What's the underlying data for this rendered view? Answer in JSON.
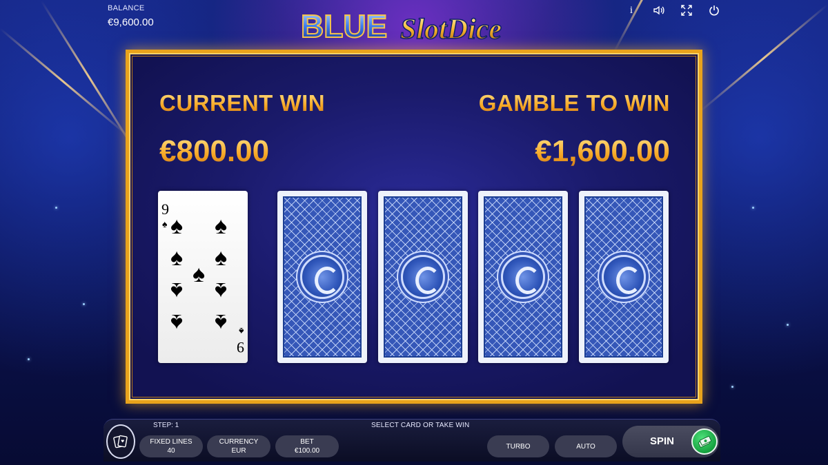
{
  "balance": {
    "label": "BALANCE",
    "value": "€9,600.00"
  },
  "logo": {
    "text_blue": "BLUE",
    "text_script": "SlotDice"
  },
  "top_icons": {
    "info": "i",
    "sound": "speaker-icon",
    "fullscreen": "fullscreen-icon",
    "power": "power-icon"
  },
  "gamble": {
    "current_win_label": "CURRENT WIN",
    "current_win_value": "€800.00",
    "gamble_label": "GAMBLE TO WIN",
    "gamble_value": "€1,600.00",
    "dealer_card": {
      "rank": "9",
      "suit": "♠"
    },
    "face_down_cards": 4
  },
  "bottom_bar": {
    "step": "STEP: 1",
    "message": "SELECT CARD OR TAKE WIN",
    "fixed_lines": {
      "label": "FIXED LINES",
      "value": "40"
    },
    "currency": {
      "label": "CURRENCY",
      "value": "EUR"
    },
    "bet": {
      "label": "BET",
      "value": "€100.00"
    },
    "turbo": "TURBO",
    "auto": "AUTO",
    "spin": "SPIN"
  },
  "colors": {
    "gold": "#f6a623",
    "frame": "#e9a31c",
    "card_back": "#3557b8",
    "spin_green": "#15a23f"
  }
}
